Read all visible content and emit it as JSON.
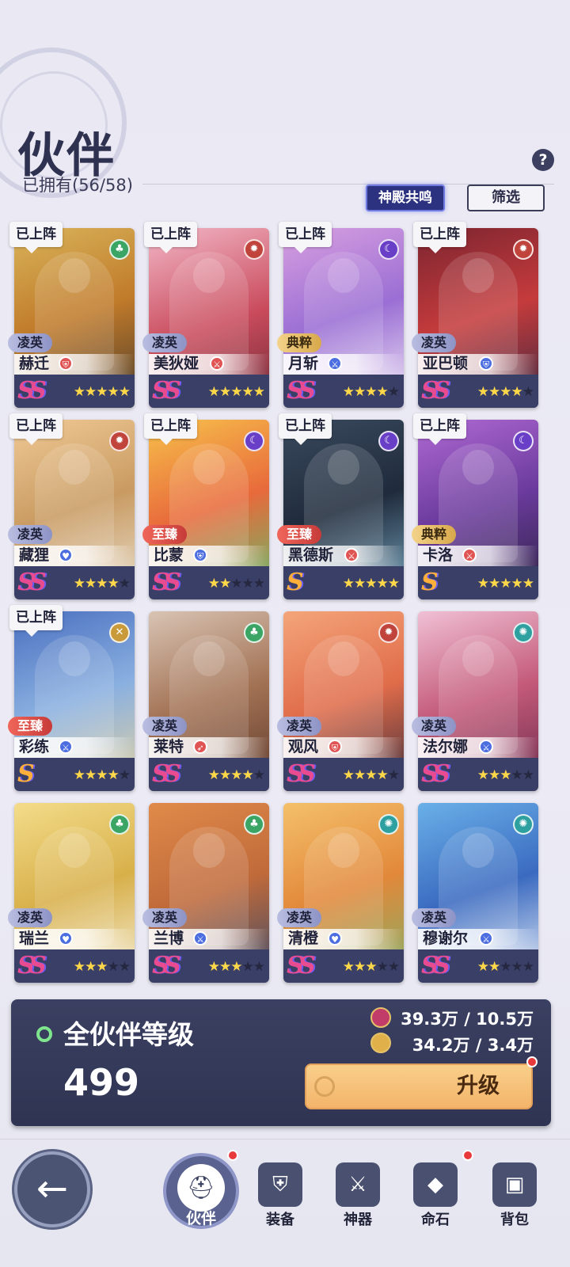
{
  "header": {
    "title": "伙伴",
    "owned_label": "已拥有(56/58)",
    "help_icon": "?",
    "temple_button": "神殿共鸣",
    "filter_button": "筛选"
  },
  "deployed_label": "已上阵",
  "cards": [
    {
      "name": "赫迁",
      "tier": "凌英",
      "tier_key": "lingying",
      "rank": "SS",
      "stars": 5,
      "deployed": true,
      "element": "leaf",
      "element_color": "#3aa564",
      "role": "shield",
      "role_color": "#e05454",
      "bg": "linear-gradient(160deg,#d9b45a,#c07a2a 50%,#4a3b2a)"
    },
    {
      "name": "美狄娅",
      "tier": "凌英",
      "tier_key": "lingying",
      "rank": "SS",
      "stars": 5,
      "deployed": true,
      "element": "flame",
      "element_color": "#c0443c",
      "role": "sword",
      "role_color": "#e05454",
      "bg": "linear-gradient(160deg,#f2b7c7,#c94b5c 55%,#6e2a36)"
    },
    {
      "name": "月斩",
      "tier": "典粹",
      "tier_key": "dianjing",
      "rank": "SS",
      "stars": 4,
      "deployed": true,
      "element": "moon",
      "element_color": "#6a3fc7",
      "role": "sword",
      "role_color": "#4d6ee0",
      "bg": "linear-gradient(160deg,#d9a0e0,#9a6ed4 50%,#f1e9f6)"
    },
    {
      "name": "亚巴顿",
      "tier": "凌英",
      "tier_key": "lingying",
      "rank": "SS",
      "stars": 4,
      "deployed": true,
      "element": "flame",
      "element_color": "#c0443c",
      "role": "shield",
      "role_color": "#4d6ee0",
      "bg": "linear-gradient(160deg,#7b2430,#c53b3c 50%,#3c2840)"
    },
    {
      "name": "藏狸",
      "tier": "凌英",
      "tier_key": "lingying",
      "rank": "SS",
      "stars": 4,
      "deployed": true,
      "element": "flame",
      "element_color": "#c0443c",
      "role": "heart",
      "role_color": "#4d6ee0",
      "bg": "linear-gradient(160deg,#f0c995,#c99b62 50%,#e8e0d0)"
    },
    {
      "name": "比蒙",
      "tier": "至臻",
      "tier_key": "zhizhen",
      "rank": "SS",
      "stars": 2,
      "deployed": true,
      "element": "moon",
      "element_color": "#6a3fc7",
      "role": "shield",
      "role_color": "#4d6ee0",
      "bg": "linear-gradient(160deg,#f7c14b,#e86a3b 50%,#5cbf6d)"
    },
    {
      "name": "黑德斯",
      "tier": "至臻",
      "tier_key": "zhizhen",
      "rank": "S",
      "stars": 5,
      "deployed": true,
      "element": "moon",
      "element_color": "#6a3fc7",
      "role": "sword",
      "role_color": "#e05454",
      "bg": "linear-gradient(160deg,#3a4a5e,#1f2b3c 50%,#7aa7c0)"
    },
    {
      "name": "卡洛",
      "tier": "典粹",
      "tier_key": "dianjing",
      "rank": "S",
      "stars": 5,
      "deployed": true,
      "element": "moon",
      "element_color": "#6a3fc7",
      "role": "sword",
      "role_color": "#e05454",
      "bg": "linear-gradient(160deg,#b06ad4,#6a3a9c 50%,#2a2240)"
    },
    {
      "name": "彩练",
      "tier": "至臻",
      "tier_key": "zhizhen",
      "rank": "S",
      "stars": 4,
      "deployed": true,
      "element": "cross",
      "element_color": "#c89a3a",
      "role": "sword",
      "role_color": "#4d6ee0",
      "bg": "linear-gradient(160deg,#4a6fc0,#8ab0e0 50%,#e5d3a0)"
    },
    {
      "name": "莱特",
      "tier": "凌英",
      "tier_key": "lingying",
      "rank": "SS",
      "stars": 4,
      "deployed": false,
      "element": "leaf",
      "element_color": "#3aa564",
      "role": "bow",
      "role_color": "#e05454",
      "bg": "linear-gradient(160deg,#d8c4b4,#a37254 50%,#5e3a2c)"
    },
    {
      "name": "观风",
      "tier": "凌英",
      "tier_key": "lingying",
      "rank": "SS",
      "stars": 4,
      "deployed": false,
      "element": "flame",
      "element_color": "#c0443c",
      "role": "shield",
      "role_color": "#e05454",
      "bg": "linear-gradient(160deg,#f4a57a,#e06c4a 50%,#3b2b3a)"
    },
    {
      "name": "法尔娜",
      "tier": "凌英",
      "tier_key": "lingying",
      "rank": "SS",
      "stars": 3,
      "deployed": false,
      "element": "wind",
      "element_color": "#2fa0a0",
      "role": "sword",
      "role_color": "#4d6ee0",
      "bg": "linear-gradient(160deg,#f0c0d4,#c45a7a 50%,#6a2a4a)"
    },
    {
      "name": "瑞兰",
      "tier": "凌英",
      "tier_key": "lingying",
      "rank": "SS",
      "stars": 3,
      "deployed": false,
      "element": "leaf",
      "element_color": "#3aa564",
      "role": "heart",
      "role_color": "#4d6ee0",
      "bg": "linear-gradient(160deg,#f3dc8a,#d8b04a 50%,#f4eed8)"
    },
    {
      "name": "兰博",
      "tier": "凌英",
      "tier_key": "lingying",
      "rank": "SS",
      "stars": 3,
      "deployed": false,
      "element": "leaf",
      "element_color": "#3aa564",
      "role": "sword",
      "role_color": "#4d6ee0",
      "bg": "linear-gradient(160deg,#e08a4a,#c06a3a 50%,#3a4a6a)"
    },
    {
      "name": "清橙",
      "tier": "凌英",
      "tier_key": "lingying",
      "rank": "SS",
      "stars": 3,
      "deployed": false,
      "element": "wind",
      "element_color": "#2fa0a0",
      "role": "heart",
      "role_color": "#4d6ee0",
      "bg": "linear-gradient(160deg,#f4c06a,#e2883a 50%,#7fb068)"
    },
    {
      "name": "穆谢尔",
      "tier": "凌英",
      "tier_key": "lingying",
      "rank": "SS",
      "stars": 2,
      "deployed": false,
      "element": "wind",
      "element_color": "#2fa0a0",
      "role": "sword",
      "role_color": "#4d6ee0",
      "bg": "linear-gradient(160deg,#6ab0e8,#3a6ac0 50%,#e8eef8)"
    }
  ],
  "level_panel": {
    "label": "全伙伴等级",
    "level": "499",
    "resource1": "39.3万 / 10.5万",
    "resource2": "34.2万 / 3.4万",
    "upgrade_button": "升级"
  },
  "nav": {
    "back_icon": "←",
    "items": [
      {
        "label": "伙伴",
        "icon": "helmet-icon",
        "glyph": "⛑"
      },
      {
        "label": "装备",
        "icon": "armor-icon",
        "glyph": "⛨"
      },
      {
        "label": "神器",
        "icon": "artifact-icon",
        "glyph": "⚔"
      },
      {
        "label": "命石",
        "icon": "stone-icon",
        "glyph": "◆"
      },
      {
        "label": "背包",
        "icon": "backpack-icon",
        "glyph": "▣"
      }
    ]
  },
  "colors": {
    "panel_bg": "#3b4062",
    "accent_gold": "#f3b46a",
    "notify_red": "#e83a3a"
  }
}
